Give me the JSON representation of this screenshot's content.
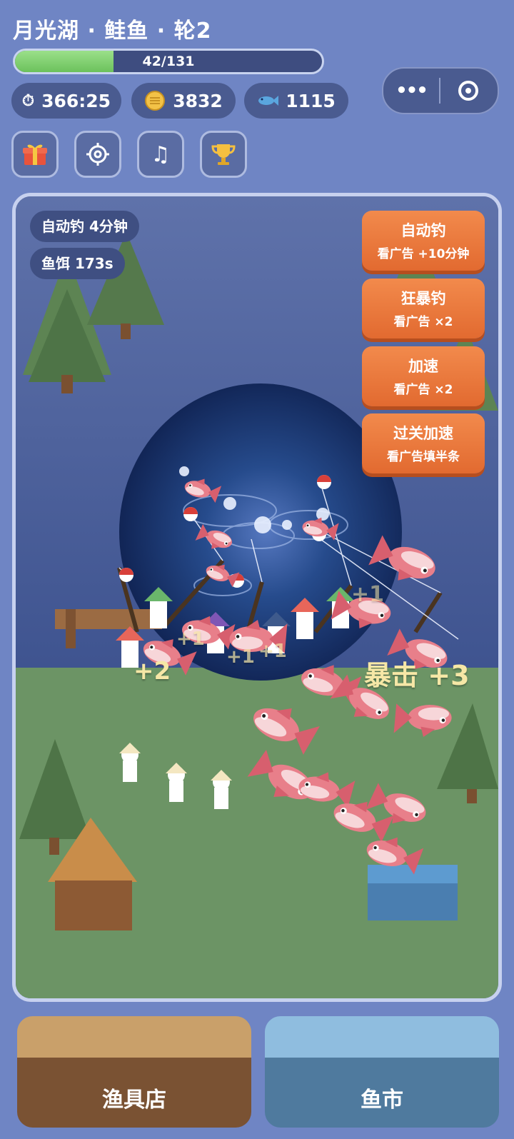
{
  "header": {
    "title": "月光湖 · 鲑鱼 · 轮2",
    "progress": {
      "text": "42/131",
      "fraction": 0.32
    }
  },
  "stats": {
    "timer": {
      "icon": "stopwatch-icon",
      "value": "366:25"
    },
    "coins": {
      "icon": "coin-icon",
      "value": "3832"
    },
    "fish": {
      "icon": "fish-icon",
      "value": "1115"
    }
  },
  "capsule": {
    "more": "•••",
    "more_icon": "more-dots-icon",
    "close_icon": "record-icon"
  },
  "toolbar": [
    "gift-icon",
    "settings-icon",
    "music-icon",
    "trophy-icon"
  ],
  "status": {
    "auto_fish": "自动钓 4分钟",
    "bait": "鱼饵 173s"
  },
  "ad_buttons": [
    {
      "title": "自动钓",
      "sub": "看广告 +10分钟"
    },
    {
      "title": "狂暴钓",
      "sub": "看广告 ×2"
    },
    {
      "title": "加速",
      "sub": "看广告 ×2"
    },
    {
      "title": "过关加速",
      "sub": "看广告填半条"
    }
  ],
  "popups": [
    "+2",
    "+1",
    "+1",
    "+1",
    "+1",
    "暴击 +3"
  ],
  "bottom": {
    "shop": "渔具店",
    "market": "鱼市"
  },
  "colors": {
    "background": "#6f85c4",
    "accent_orange": "#e26a30",
    "progress_green": "#7fd06c",
    "fish_pink": "#e87f8a"
  }
}
